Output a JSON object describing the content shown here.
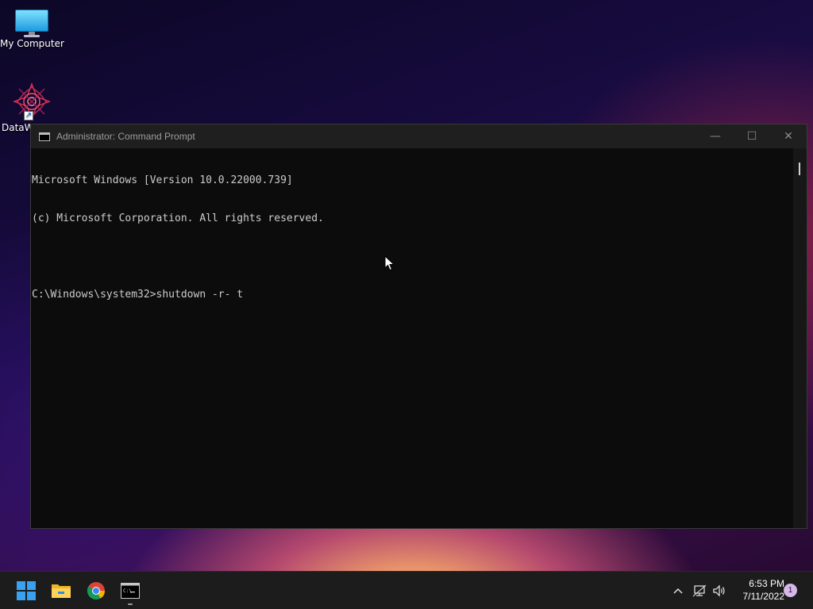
{
  "desktop": {
    "icons": [
      {
        "label": "My Computer"
      },
      {
        "label": "DataW"
      }
    ]
  },
  "window": {
    "title": "Administrator: Command Prompt",
    "controls": {
      "minimize": "—",
      "maximize": "☐",
      "close": "✕"
    },
    "console_lines": [
      "Microsoft Windows [Version 10.0.22000.739]",
      "(c) Microsoft Corporation. All rights reserved.",
      "",
      "C:\\Windows\\system32>shutdown -r- t"
    ]
  },
  "taskbar": {
    "apps": [
      "start-button",
      "file-explorer",
      "google-chrome",
      "command-prompt"
    ],
    "tray": {
      "chevron": "^",
      "time": "6:53 PM",
      "date": "7/11/2022",
      "notification_count": "1"
    }
  },
  "colors": {
    "console_bg": "#0c0c0c",
    "console_text": "#cccccc",
    "titlebar_bg": "#1f1f1f",
    "taskbar_bg": "#1c1c1c"
  }
}
